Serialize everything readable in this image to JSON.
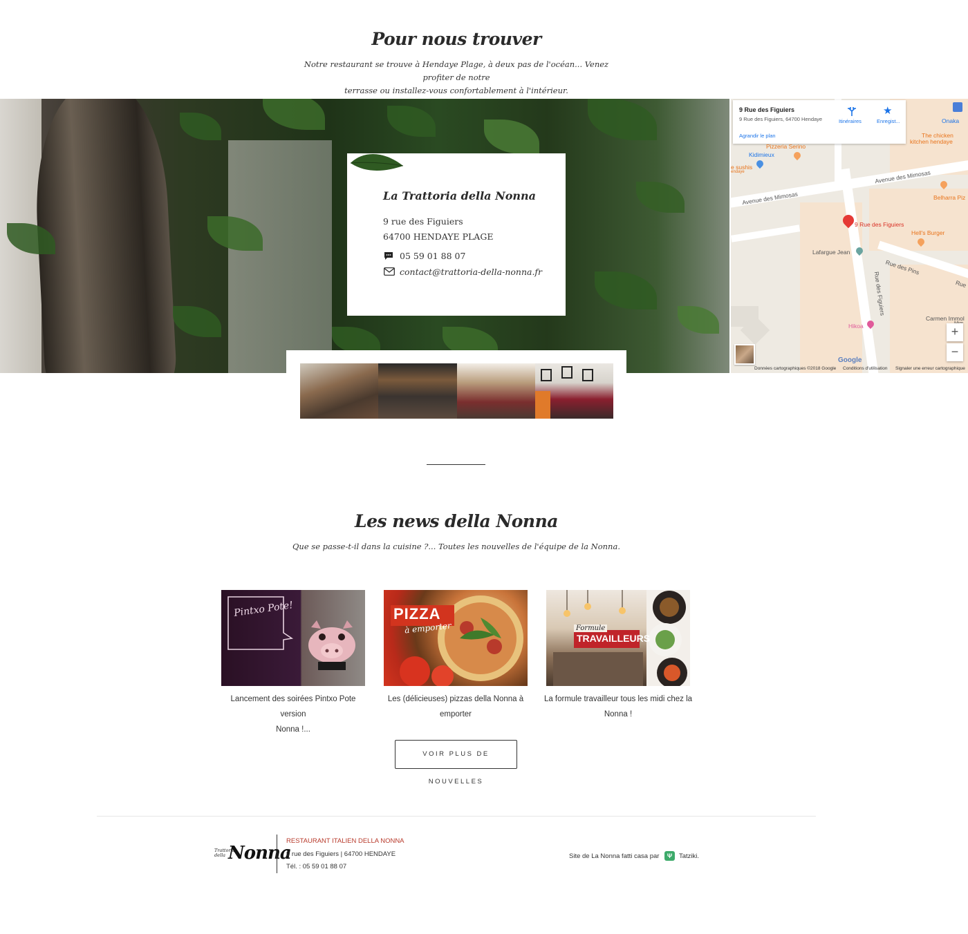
{
  "find_section": {
    "title": "Pour nous trouver",
    "subtitle_line1": "Notre restaurant se trouve à Hendaye Plage, à deux pas de l'océan... Venez profiter de notre",
    "subtitle_line2": "terrasse ou installez-vous confortablement à l'intérieur."
  },
  "contact_card": {
    "name": "La Trattoria della Nonna",
    "street": "9 rue des Figuiers",
    "city": "64700 HENDAYE PLAGE",
    "phone": "05 59 01 88 07",
    "email": "contact@trattoria-della-nonna.fr",
    "phone_icon": "chat-bubble-icon",
    "email_icon": "envelope-icon"
  },
  "map": {
    "place_title": "9 Rue des Figuiers",
    "place_address": "9 Rue des Figuiers, 64700 Hendaye",
    "enlarge_link": "Agrandir le plan",
    "directions_label": "Itinéraires",
    "save_label": "Enregist...",
    "labels": {
      "onaka": "Onaka",
      "chicken_line1": "The chicken",
      "chicken_line2": "kitchen hendaye",
      "pizzeria": "Pizzeria Serino",
      "kidimieux": "Kidimieux",
      "sushis_line1": "e sushis",
      "sushis_line2": "endaye",
      "avenue_mimosas_1": "Avenue des Mimosas",
      "avenue_mimosas_2": "Avenue des Mimosas",
      "belharra": "Belharra Piz",
      "pin_label": "9 Rue des Figuiers",
      "hells_burger": "Hell's Burger",
      "lafargue": "Lafargue Jean",
      "rue_pins": "Rue des Pins",
      "rue_figuiers": "Rue des Figuiers",
      "rue": "Rue",
      "hikoa": "Hikoa",
      "carmen_line1": "Carmen Immol",
      "carmen_line2": "Mim"
    },
    "zoom_in": "+",
    "zoom_out": "−",
    "google": "Google",
    "footer_data": "Données cartographiques ©2018 Google",
    "footer_terms": "Conditions d'utilisation",
    "footer_report": "Signaler une erreur cartographique"
  },
  "news_section": {
    "title": "Les news della Nonna",
    "subtitle": "Que se passe-t-il dans la cuisine ?... Toutes les nouvelles de l'équipe de la Nonna.",
    "items": [
      {
        "caption_line1": "Lancement des soirées Pintxo Pote version",
        "caption_line2": "Nonna !...",
        "img_text": "Pintxo Pote!"
      },
      {
        "caption_line1": "Les (délicieuses) pizzas della Nonna à",
        "caption_line2": "emporter",
        "img_text_1": "PIZZA",
        "img_text_2": "à emporter"
      },
      {
        "caption_line1": "La formule travailleur tous les midi chez la",
        "caption_line2": "Nonna !",
        "img_text_1": "Formule",
        "img_text_2": "TRAVAILLEURS"
      }
    ],
    "more_button": "VOIR PLUS DE NOUVELLES"
  },
  "footer": {
    "logo_top": "Trattoria della",
    "logo_main": "Nonna",
    "restaurant_name": "RESTAURANT ITALIEN DELLA NONNA",
    "address": "9 rue des Figuiers | 64700 HENDAYE",
    "phone": "Tél. : 05 59 01 88 07",
    "credit_text": "Site de La Nonna fatti casa par",
    "credit_brand": "Tatziki."
  },
  "colors": {
    "accent_red": "#b83a2b",
    "map_blue": "#1a73e8",
    "map_pin": "#e53935",
    "poi_orange": "#f5a15c"
  }
}
